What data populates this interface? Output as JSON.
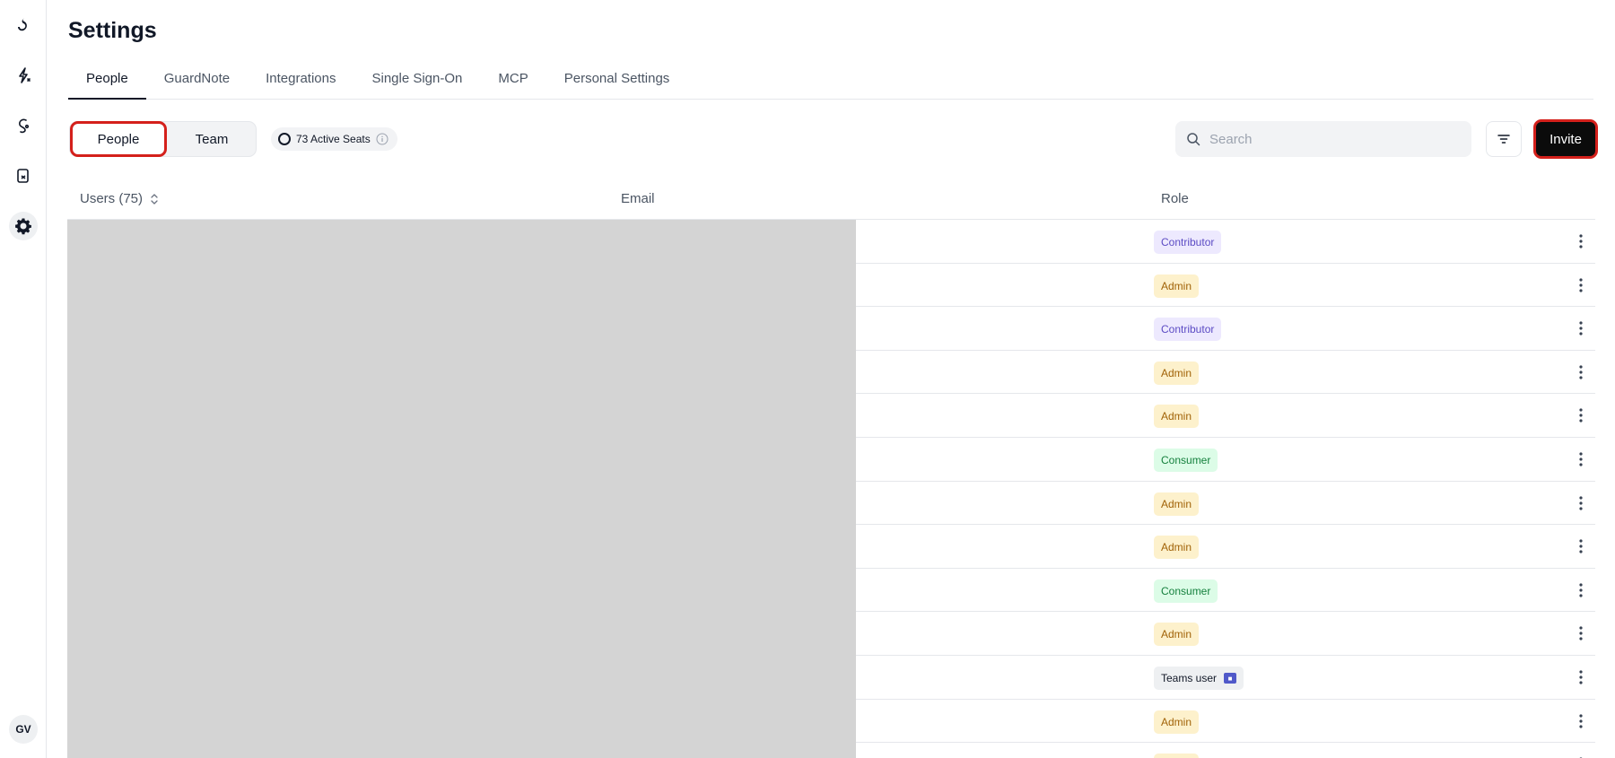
{
  "rail": {
    "icons": [
      "brand-logo-icon",
      "flash-rocket-icon",
      "guard-agent-icon",
      "documents-icon",
      "settings-gear-icon"
    ],
    "avatar_initials": "GV"
  },
  "header": {
    "title": "Settings"
  },
  "tabs": [
    {
      "label": "People",
      "active": true
    },
    {
      "label": "GuardNote",
      "active": false
    },
    {
      "label": "Integrations",
      "active": false
    },
    {
      "label": "Single Sign-On",
      "active": false
    },
    {
      "label": "MCP",
      "active": false
    },
    {
      "label": "Personal Settings",
      "active": false
    }
  ],
  "toolbar": {
    "segment_people": "People",
    "segment_team": "Team",
    "seats_label": "73 Active Seats",
    "search_placeholder": "Search",
    "search_value": "",
    "invite_label": "Invite"
  },
  "table": {
    "col_users": "Users (75)",
    "col_email": "Email",
    "col_role": "Role",
    "rows": [
      {
        "role": "Contributor",
        "kind": "contributor"
      },
      {
        "role": "Admin",
        "kind": "admin"
      },
      {
        "role": "Contributor",
        "kind": "contributor"
      },
      {
        "role": "Admin",
        "kind": "admin"
      },
      {
        "role": "Admin",
        "kind": "admin"
      },
      {
        "role": "Consumer",
        "kind": "consumer"
      },
      {
        "role": "Admin",
        "kind": "admin"
      },
      {
        "role": "Admin",
        "kind": "admin"
      },
      {
        "role": "Consumer",
        "kind": "consumer"
      },
      {
        "role": "Admin",
        "kind": "admin"
      },
      {
        "role": "Teams user",
        "kind": "teams"
      },
      {
        "role": "Admin",
        "kind": "admin"
      },
      {
        "role": "Admin",
        "kind": "admin"
      }
    ]
  },
  "colors": {
    "accent_dark": "#0b0b0b",
    "highlight_red": "#d4201b",
    "redaction_gray": "#d4d4d4"
  }
}
